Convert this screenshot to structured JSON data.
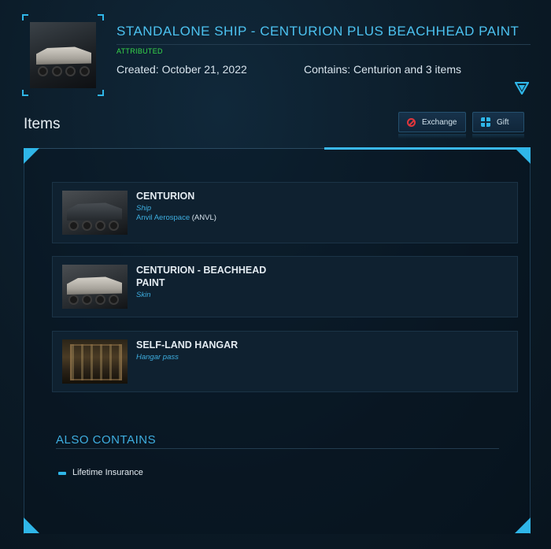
{
  "header": {
    "title": "STANDALONE SHIP - CENTURION PLUS BEACHHEAD PAINT",
    "status": "ATTRIBUTED",
    "created": "Created: October 21, 2022",
    "contains": "Contains: Centurion and 3 items",
    "expand_icon": "triangle-down-icon"
  },
  "items_section": {
    "heading": "Items",
    "exchange_label": "Exchange",
    "gift_label": "Gift",
    "items": [
      {
        "name": "CENTURION",
        "type": "Ship",
        "manufacturer": "Anvil Aerospace",
        "manufacturer_code": "(ANVL)"
      },
      {
        "name": "CENTURION - BEACHHEAD PAINT",
        "type": "Skin"
      },
      {
        "name": "SELF-LAND HANGAR",
        "type": "Hangar pass"
      }
    ]
  },
  "also_contains": {
    "title": "ALSO CONTAINS",
    "items": [
      "Lifetime Insurance"
    ]
  },
  "colors": {
    "accent": "#2fb6e8",
    "title": "#4cc2f0",
    "attributed": "#37d84a",
    "background": "#0b1a26"
  }
}
